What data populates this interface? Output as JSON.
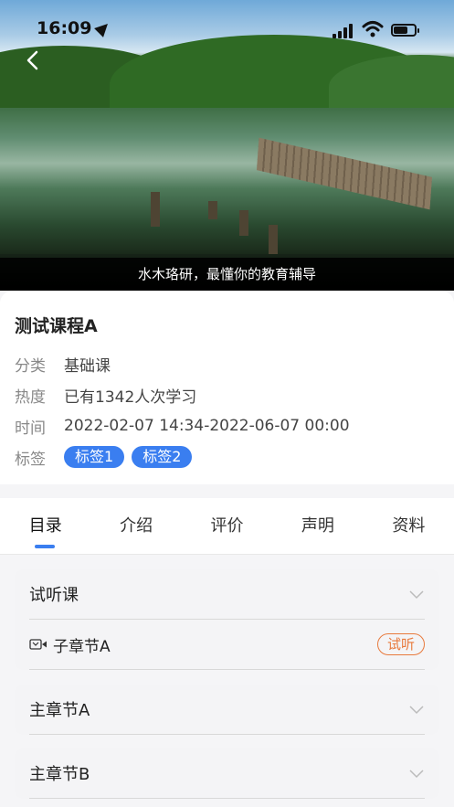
{
  "status_bar": {
    "time": "16:09"
  },
  "hero": {
    "caption": "水木珞研，最懂你的教育辅导"
  },
  "course": {
    "title": "测试课程A",
    "rows": [
      {
        "key": "分类",
        "value": "基础课"
      },
      {
        "key": "热度",
        "value": "已有1342人次学习"
      },
      {
        "key": "时间",
        "value": "2022-02-07 14:34-2022-06-07 00:00"
      }
    ],
    "tags_key": "标签",
    "tags": [
      "标签1",
      "标签2"
    ],
    "tag_color": "#3a7ef0"
  },
  "tabs": [
    "目录",
    "介绍",
    "评价",
    "声明",
    "资料"
  ],
  "active_tab": "目录",
  "catalog": [
    {
      "title": "试听课",
      "lessons": [
        {
          "label": "子章节A",
          "badge": "试听"
        }
      ]
    },
    {
      "title": "主章节A",
      "lessons": []
    },
    {
      "title": "主章节B",
      "lessons": []
    }
  ],
  "accent_color": "#3a7ef0",
  "badge_color": "#e87a3d"
}
